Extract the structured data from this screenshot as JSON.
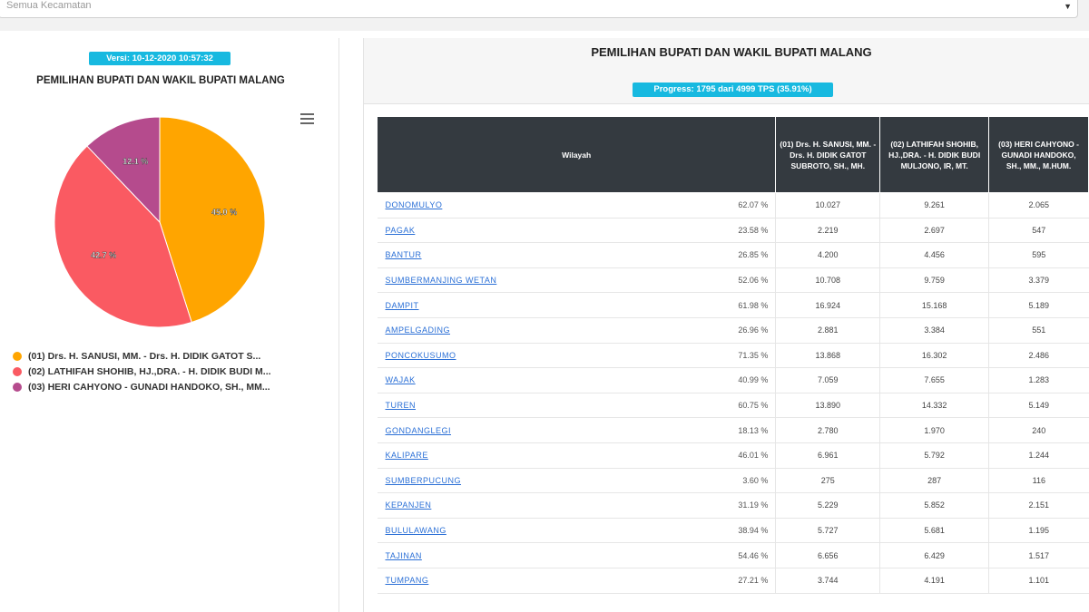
{
  "filter": {
    "placeholder": "Semua Kecamatan"
  },
  "left": {
    "version": "Versi: 10-12-2020 10:57:32",
    "title": "PEMILIHAN BUPATI DAN WAKIL BUPATI MALANG",
    "menu_icon": "hamburger-menu-icon",
    "chart_data": {
      "type": "pie",
      "slices": [
        {
          "label": "(01) Drs. H. SANUSI, MM. - Drs. H. DIDIK GATOT S...",
          "value": 45.0,
          "display": "45.0 %",
          "color": "#ffa500"
        },
        {
          "label": "(02) LATHIFAH SHOHIB, HJ.,DRA. - H. DIDIK BUDI M...",
          "value": 42.7,
          "display": "42.7 %",
          "color": "#fa5a62"
        },
        {
          "label": "(03) HERI CAHYONO - GUNADI HANDOKO, SH., MM...",
          "value": 12.1,
          "display": "12.1 %",
          "color": "#b54b8d"
        }
      ]
    }
  },
  "right": {
    "title": "PEMILIHAN BUPATI DAN WAKIL BUPATI MALANG",
    "progress": "Progress: 1795 dari 4999 TPS (35.91%)",
    "headers": {
      "wilayah": "Wilayah",
      "c1": "(01) Drs. H. SANUSI, MM. - Drs. H. DIDIK GATOT SUBROTO, SH., MH.",
      "c2": "(02) LATHIFAH SHOHIB, HJ.,DRA. - H. DIDIK BUDI MULJONO, IR, MT.",
      "c3": "(03) HERI CAHYONO - GUNADI HANDOKO, SH., MM., M.HUM."
    },
    "rows": [
      {
        "wilayah": "DONOMULYO",
        "pct": "62.07 %",
        "v1": "10.027",
        "v2": "9.261",
        "v3": "2.065"
      },
      {
        "wilayah": "PAGAK",
        "pct": "23.58 %",
        "v1": "2.219",
        "v2": "2.697",
        "v3": "547"
      },
      {
        "wilayah": "BANTUR",
        "pct": "26.85 %",
        "v1": "4.200",
        "v2": "4.456",
        "v3": "595"
      },
      {
        "wilayah": "SUMBERMANJING WETAN",
        "pct": "52.06 %",
        "v1": "10.708",
        "v2": "9.759",
        "v3": "3.379"
      },
      {
        "wilayah": "DAMPIT",
        "pct": "61.98 %",
        "v1": "16.924",
        "v2": "15.168",
        "v3": "5.189"
      },
      {
        "wilayah": "AMPELGADING",
        "pct": "26.96 %",
        "v1": "2.881",
        "v2": "3.384",
        "v3": "551"
      },
      {
        "wilayah": "PONCOKUSUMO",
        "pct": "71.35 %",
        "v1": "13.868",
        "v2": "16.302",
        "v3": "2.486"
      },
      {
        "wilayah": "WAJAK",
        "pct": "40.99 %",
        "v1": "7.059",
        "v2": "7.655",
        "v3": "1.283"
      },
      {
        "wilayah": "TUREN",
        "pct": "60.75 %",
        "v1": "13.890",
        "v2": "14.332",
        "v3": "5.149"
      },
      {
        "wilayah": "GONDANGLEGI",
        "pct": "18.13 %",
        "v1": "2.780",
        "v2": "1.970",
        "v3": "240"
      },
      {
        "wilayah": "KALIPARE",
        "pct": "46.01 %",
        "v1": "6.961",
        "v2": "5.792",
        "v3": "1.244"
      },
      {
        "wilayah": "SUMBERPUCUNG",
        "pct": "3.60 %",
        "v1": "275",
        "v2": "287",
        "v3": "116"
      },
      {
        "wilayah": "KEPANJEN",
        "pct": "31.19 %",
        "v1": "5.229",
        "v2": "5.852",
        "v3": "2.151"
      },
      {
        "wilayah": "BULULAWANG",
        "pct": "38.94 %",
        "v1": "5.727",
        "v2": "5.681",
        "v3": "1.195"
      },
      {
        "wilayah": "TAJINAN",
        "pct": "54.46 %",
        "v1": "6.656",
        "v2": "6.429",
        "v3": "1.517"
      },
      {
        "wilayah": "TUMPANG",
        "pct": "27.21 %",
        "v1": "3.744",
        "v2": "4.191",
        "v3": "1.101"
      }
    ]
  }
}
